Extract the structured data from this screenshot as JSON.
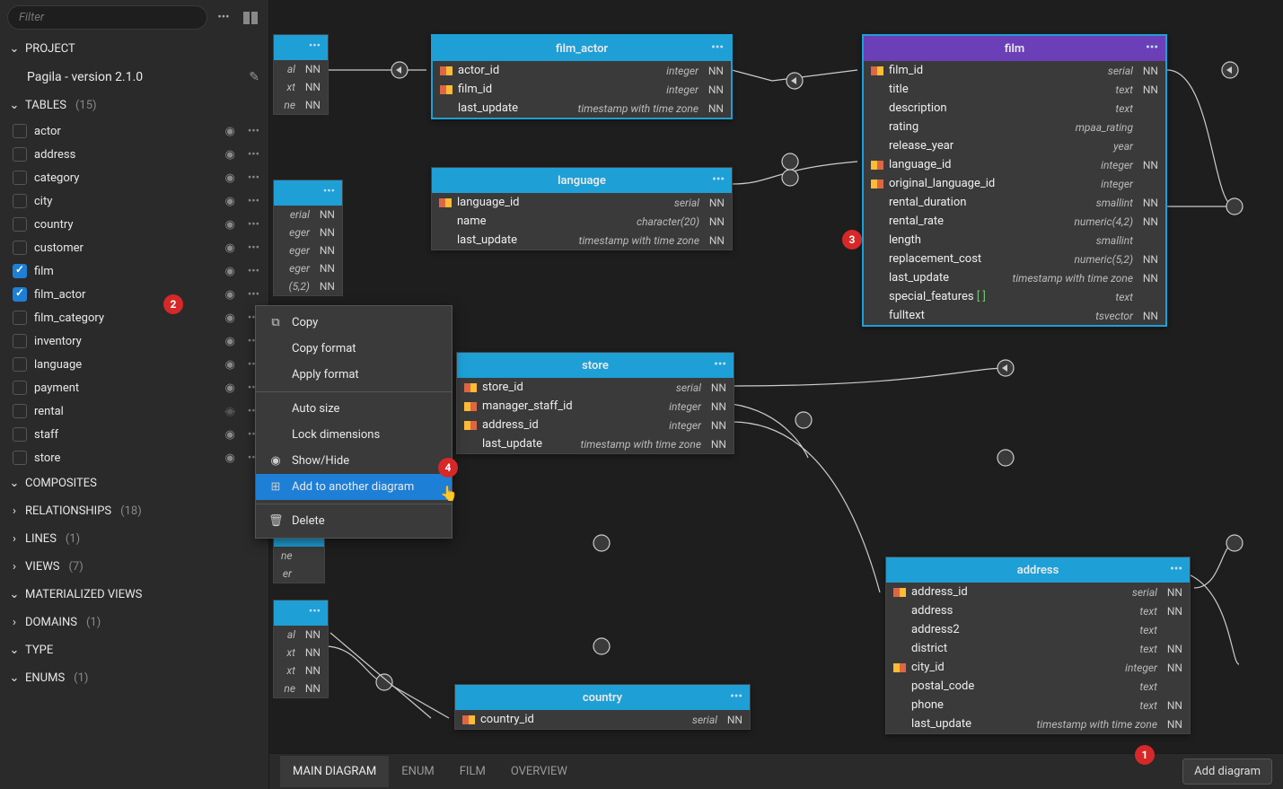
{
  "filter": {
    "placeholder": "Filter"
  },
  "sidebar": {
    "project_label": "PROJECT",
    "project_name": "Pagila - version 2.1.0",
    "tables_label": "TABLES",
    "tables_count": "(15)",
    "tables": [
      {
        "name": "actor",
        "checked": false,
        "hidden": false
      },
      {
        "name": "address",
        "checked": false,
        "hidden": false
      },
      {
        "name": "category",
        "checked": false,
        "hidden": false
      },
      {
        "name": "city",
        "checked": false,
        "hidden": false
      },
      {
        "name": "country",
        "checked": false,
        "hidden": false
      },
      {
        "name": "customer",
        "checked": false,
        "hidden": false
      },
      {
        "name": "film",
        "checked": true,
        "hidden": false
      },
      {
        "name": "film_actor",
        "checked": true,
        "hidden": false
      },
      {
        "name": "film_category",
        "checked": false,
        "hidden": false
      },
      {
        "name": "inventory",
        "checked": false,
        "hidden": false
      },
      {
        "name": "language",
        "checked": false,
        "hidden": false
      },
      {
        "name": "payment",
        "checked": false,
        "hidden": false
      },
      {
        "name": "rental",
        "checked": false,
        "hidden": true
      },
      {
        "name": "staff",
        "checked": false,
        "hidden": false
      },
      {
        "name": "store",
        "checked": false,
        "hidden": false
      }
    ],
    "composites_label": "COMPOSITES",
    "relationships_label": "RELATIONSHIPS",
    "relationships_count": "(18)",
    "lines_label": "LINES",
    "lines_count": "(1)",
    "views_label": "VIEWS",
    "views_count": "(7)",
    "matviews_label": "MATERIALIZED VIEWS",
    "domains_label": "DOMAINS",
    "domains_count": "(1)",
    "type_label": "TYPE",
    "enums_label": "ENUMS",
    "enums_count": "(1)"
  },
  "context_menu": {
    "copy": "Copy",
    "copy_format": "Copy format",
    "apply_format": "Apply format",
    "auto_size": "Auto size",
    "lock_dimensions": "Lock dimensions",
    "show_hide": "Show/Hide",
    "add_diagram": "Add to another diagram",
    "delete": "Delete"
  },
  "entities": {
    "film_actor": {
      "title": "film_actor",
      "cols": [
        {
          "k": "pk",
          "name": "actor_id",
          "type": "integer",
          "nn": "NN"
        },
        {
          "k": "pk",
          "name": "film_id",
          "type": "integer",
          "nn": "NN"
        },
        {
          "k": "",
          "name": "last_update",
          "type": "timestamp with time zone",
          "nn": "NN"
        }
      ]
    },
    "film": {
      "title": "film",
      "cols": [
        {
          "k": "pk",
          "name": "film_id",
          "type": "serial",
          "nn": "NN"
        },
        {
          "k": "",
          "name": "title",
          "type": "text",
          "nn": "NN"
        },
        {
          "k": "",
          "name": "description",
          "type": "text",
          "nn": ""
        },
        {
          "k": "",
          "name": "rating",
          "type": "mpaa_rating",
          "nn": ""
        },
        {
          "k": "",
          "name": "release_year",
          "type": "year",
          "nn": ""
        },
        {
          "k": "fk",
          "name": "language_id",
          "type": "integer",
          "nn": "NN"
        },
        {
          "k": "fk",
          "name": "original_language_id",
          "type": "integer",
          "nn": ""
        },
        {
          "k": "",
          "name": "rental_duration",
          "type": "smallint",
          "nn": "NN"
        },
        {
          "k": "",
          "name": "rental_rate",
          "type": "numeric(4,2)",
          "nn": "NN"
        },
        {
          "k": "",
          "name": "length",
          "type": "smallint",
          "nn": ""
        },
        {
          "k": "",
          "name": "replacement_cost",
          "type": "numeric(5,2)",
          "nn": "NN"
        },
        {
          "k": "",
          "name": "last_update",
          "type": "timestamp with time zone",
          "nn": "NN"
        },
        {
          "k": "",
          "name": "special_features",
          "type": "text",
          "nn": "",
          "arr": true
        },
        {
          "k": "",
          "name": "fulltext",
          "type": "tsvector",
          "nn": "NN"
        }
      ]
    },
    "language": {
      "title": "language",
      "cols": [
        {
          "k": "pk",
          "name": "language_id",
          "type": "serial",
          "nn": "NN"
        },
        {
          "k": "",
          "name": "name",
          "type": "character(20)",
          "nn": "NN"
        },
        {
          "k": "",
          "name": "last_update",
          "type": "timestamp with time zone",
          "nn": "NN"
        }
      ]
    },
    "store": {
      "title": "store",
      "cols": [
        {
          "k": "pk",
          "name": "store_id",
          "type": "serial",
          "nn": "NN"
        },
        {
          "k": "fk",
          "name": "manager_staff_id",
          "type": "integer",
          "nn": "NN"
        },
        {
          "k": "fk",
          "name": "address_id",
          "type": "integer",
          "nn": "NN"
        },
        {
          "k": "",
          "name": "last_update",
          "type": "timestamp with time zone",
          "nn": "NN"
        }
      ]
    },
    "country": {
      "title": "country",
      "cols": [
        {
          "k": "pk",
          "name": "country_id",
          "type": "serial",
          "nn": "NN"
        }
      ]
    },
    "address": {
      "title": "address",
      "cols": [
        {
          "k": "pk",
          "name": "address_id",
          "type": "serial",
          "nn": "NN"
        },
        {
          "k": "",
          "name": "address",
          "type": "text",
          "nn": "NN"
        },
        {
          "k": "",
          "name": "address2",
          "type": "text",
          "nn": ""
        },
        {
          "k": "",
          "name": "district",
          "type": "text",
          "nn": "NN"
        },
        {
          "k": "fk",
          "name": "city_id",
          "type": "integer",
          "nn": "NN"
        },
        {
          "k": "",
          "name": "postal_code",
          "type": "text",
          "nn": ""
        },
        {
          "k": "",
          "name": "phone",
          "type": "text",
          "nn": "NN"
        },
        {
          "k": "",
          "name": "last_update",
          "type": "timestamp with time zone",
          "nn": "NN"
        }
      ]
    }
  },
  "tabs": {
    "main": "MAIN DIAGRAM",
    "enum": "ENUM",
    "film": "FILM",
    "overview": "OVERVIEW",
    "add": "Add diagram"
  },
  "badges": {
    "b1": "1",
    "b2": "2",
    "b3": "3",
    "b4": "4"
  },
  "stub1": {
    "rows": [
      {
        "t": "al",
        "nn": "NN"
      },
      {
        "t": "xt",
        "nn": "NN"
      },
      {
        "t": "ne",
        "nn": "NN"
      }
    ]
  },
  "stub2": {
    "rows": [
      {
        "t": "erial",
        "nn": "NN"
      },
      {
        "t": "eger",
        "nn": "NN"
      },
      {
        "t": "eger",
        "nn": "NN"
      },
      {
        "t": "eger",
        "nn": "NN"
      },
      {
        "t": "(5,2)",
        "nn": "NN"
      }
    ]
  },
  "stub3": {
    "rows": [
      {
        "t": "ne",
        "nn": ""
      },
      {
        "t": "er",
        "nn": ""
      }
    ]
  },
  "stub4": {
    "rows": [
      {
        "t": "al",
        "nn": "NN"
      },
      {
        "t": "xt",
        "nn": "NN"
      },
      {
        "t": "xt",
        "nn": "NN"
      },
      {
        "t": "ne",
        "nn": "NN"
      }
    ]
  }
}
